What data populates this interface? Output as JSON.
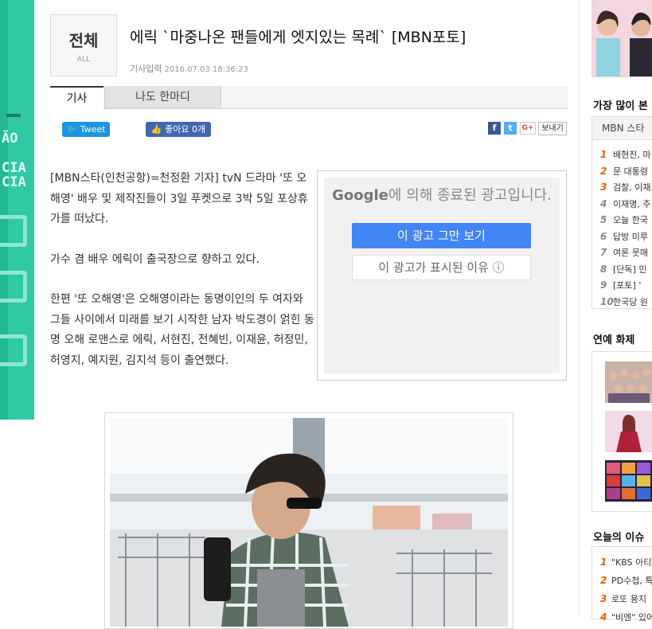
{
  "category": {
    "korean": "전체",
    "english": "ALL"
  },
  "article": {
    "headline": "에릭 `마중나온 팬들에게 엣지있는 목례` [MBN포토]",
    "date_label": "기사입력",
    "date_value": "2016.07.03 18:36:23",
    "paragraphs": [
      "[MBN스타(인천공항)=천정환 기자] tvN 드라마 '또 오해영' 배우 및 제작진들이 3일 푸켓으로 3박 5일 포상휴가를 떠났다.",
      "가수 겸 배우 에릭이 출국장으로 향하고 있다.",
      "한편 '또 오해영'은 오해영이라는 동명이인의 두 여자와 그들 사이에서 미래를 보기 시작한 남자 박도경이 얽힌 동명 오해 로맨스로 에릭, 서현진, 전혜빈, 이재윤, 허정민, 허영지, 예지원, 김지석 등이 출연했다."
    ]
  },
  "tabs": {
    "article": "기사",
    "comments": "나도 한마디"
  },
  "social": {
    "tweet": "Tweet",
    "like": "좋아요 0개",
    "facebook_icon": "f",
    "twitter_icon": "t",
    "google_icon": "G+",
    "send": "보내기"
  },
  "ad": {
    "brand": "Google",
    "title_rest": "에 의해 종료된 광고입니다.",
    "stop_button": "이 광고 그만 보기",
    "why_button": "이 광고가 표시된 이유 ⓘ"
  },
  "sidebar": {
    "most_viewed_title": "가장 많이 본 뉴",
    "most_viewed_tab": "MBN 스타",
    "most_viewed": [
      {
        "rank": "1",
        "title": "배현진, 마"
      },
      {
        "rank": "2",
        "title": "문 대통령"
      },
      {
        "rank": "3",
        "title": "검찰, 이재"
      },
      {
        "rank": "4",
        "title": "이재명, 주"
      },
      {
        "rank": "5",
        "title": "오늘 한국"
      },
      {
        "rank": "6",
        "title": "답방 미루"
      },
      {
        "rank": "7",
        "title": "여론 뭇매"
      },
      {
        "rank": "8",
        "title": "[단독] 민"
      },
      {
        "rank": "9",
        "title": "[포토] '"
      },
      {
        "rank": "10",
        "title": "한국당 원"
      }
    ],
    "entertainment_title": "연예 화제",
    "today_issue_title": "오늘의 이슈",
    "today_issue": [
      {
        "rank": "1",
        "title": "\"KBS 아티"
      },
      {
        "rank": "2",
        "title": "PD수첩, 특"
      },
      {
        "rank": "3",
        "title": "로또 용지"
      },
      {
        "rank": "4",
        "title": "\"비엔\" 있어"
      }
    ]
  },
  "colors": {
    "accent_orange": "#f25a00",
    "google_blue": "#4285f4",
    "twitter_blue": "#1b95e0",
    "facebook_blue": "#4267b2",
    "banner_green": "#2fc9a6"
  }
}
